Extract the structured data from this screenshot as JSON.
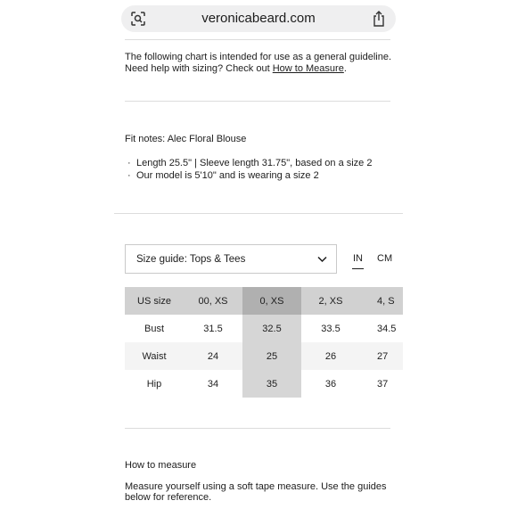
{
  "browser": {
    "url": "veronicabeard.com"
  },
  "intro": {
    "text": "The following chart is intended for use as a general guideline. Need help with sizing? Check out ",
    "link": "How to Measure",
    "suffix": "."
  },
  "fit_notes": {
    "title": "Fit notes: Alec Floral Blouse",
    "items": [
      "Length 25.5\" | Sleeve length 31.75\", based on a size 2",
      "Our model is 5'10\" and is wearing a size 2"
    ]
  },
  "size_guide": {
    "selected": "Size guide: Tops & Tees",
    "units": [
      "IN",
      "CM"
    ],
    "active_unit": "IN",
    "table": {
      "headers": [
        "US size",
        "00, XS",
        "0, XS",
        "2, XS",
        "4, S"
      ],
      "rows": [
        [
          "Bust",
          "31.5",
          "32.5",
          "33.5",
          "34.5"
        ],
        [
          "Waist",
          "24",
          "25",
          "26",
          "27"
        ],
        [
          "Hip",
          "34",
          "35",
          "36",
          "37"
        ]
      ],
      "highlighted_column": "0, XS"
    }
  },
  "how_to_measure": {
    "title": "How to measure",
    "body": "Measure yourself using a soft tape measure. Use the guides below for reference."
  },
  "colors": {
    "header_bg": "#d1d1d1",
    "highlight_bg": "#b0b0b0",
    "text": "#1d1d1d"
  }
}
